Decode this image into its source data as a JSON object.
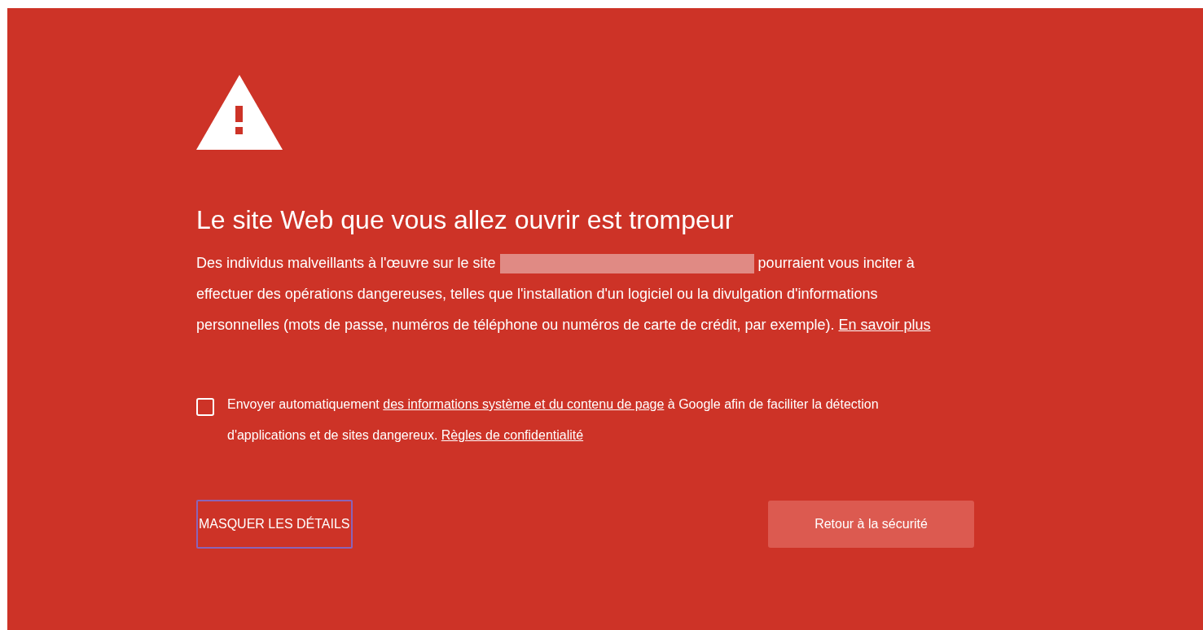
{
  "heading": "Le site Web que vous allez ouvrir est trompeur",
  "description": {
    "before": "Des individus malveillants à l'œuvre sur le site",
    "after": "pourraient vous inciter à effectuer des opérations dangereuses, telles que l'installation d'un logiciel ou la divulgation d'informations personnelles (mots de passe, numéros de téléphone ou numéros de carte de crédit, par exemple).",
    "link": "En savoir plus"
  },
  "report": {
    "checked": false,
    "before": "Envoyer automatiquement",
    "link": "des informations système et du contenu de page",
    "middle": "à Google afin de faciliter la détection d'applications et de sites dangereux.",
    "privacy_link": "Règles de confidentialité"
  },
  "buttons": {
    "details": "MASQUER LES DÉTAILS",
    "back": "Retour à la sécurité"
  }
}
